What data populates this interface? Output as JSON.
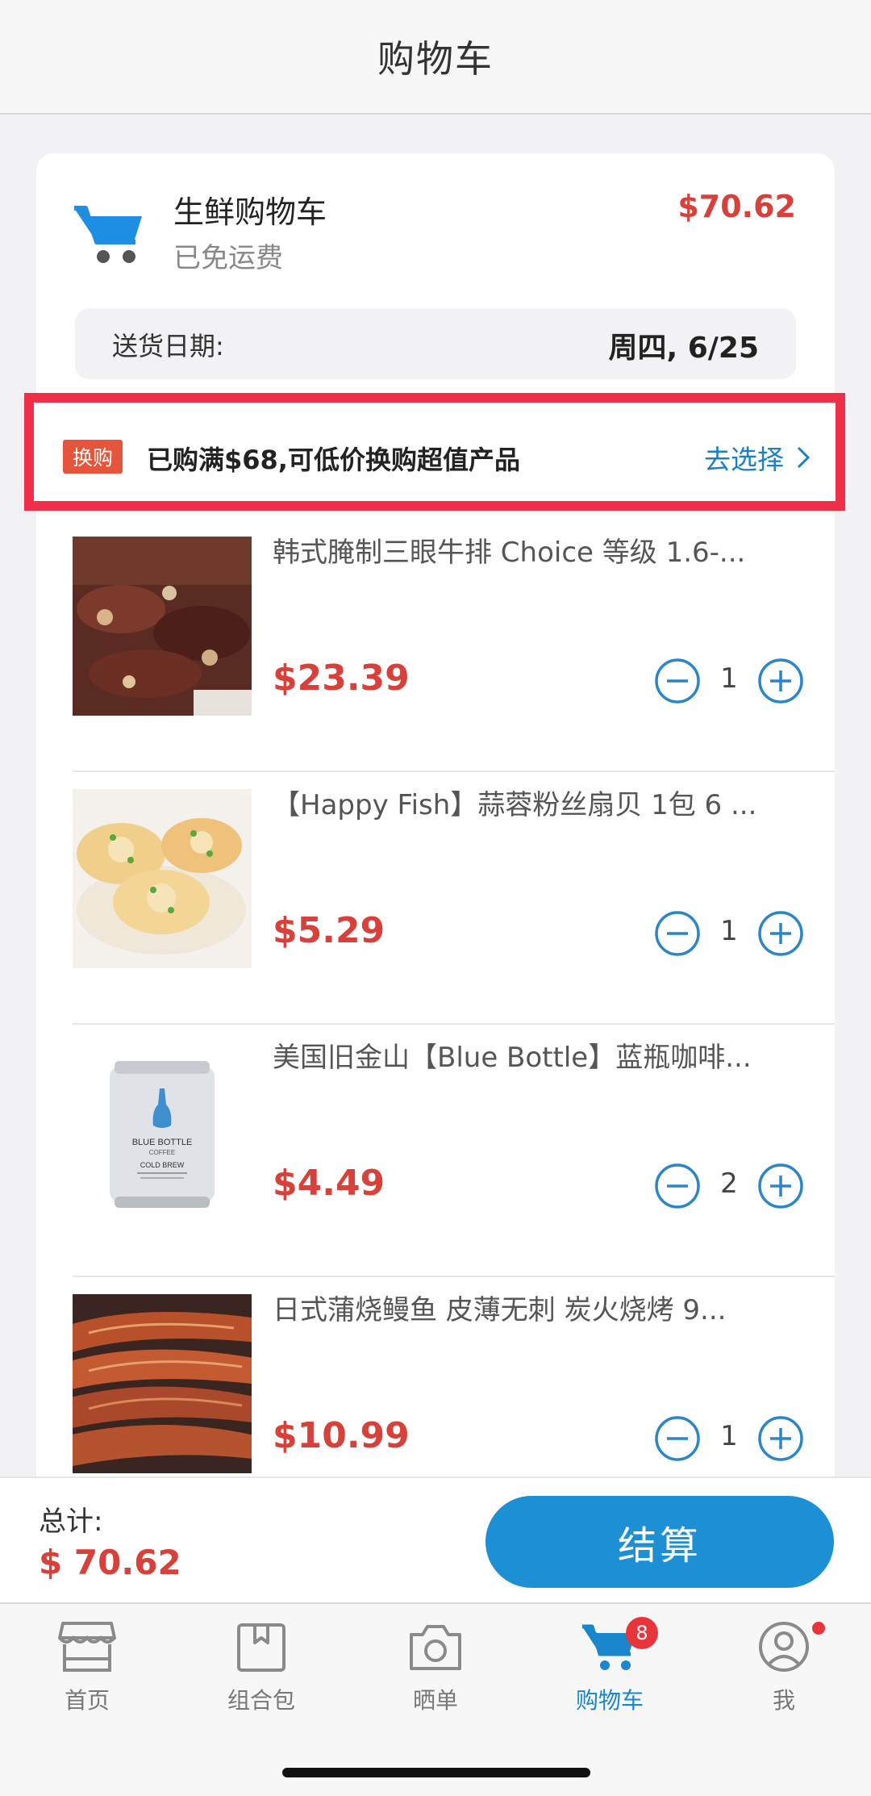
{
  "header": {
    "title": "购物车"
  },
  "cart": {
    "name": "生鲜购物车",
    "shipping_note": "已免运费",
    "total": "$70.62",
    "delivery_label": "送货日期:",
    "delivery_value": "周四, 6/25"
  },
  "promo": {
    "badge": "换购",
    "text": "已购满$68,可低价换购超值产品",
    "link": "去选择"
  },
  "items": [
    {
      "name": "韩式腌制三眼牛排 Choice 等级 1.6-...",
      "price": "$23.39",
      "qty": "1",
      "image": "beef-short-ribs-photo"
    },
    {
      "name": "【Happy Fish】蒜蓉粉丝扇贝 1包 6 ...",
      "price": "$5.29",
      "qty": "1",
      "image": "garlic-scallops-photo"
    },
    {
      "name": "美国旧金山【Blue Bottle】蓝瓶咖啡...",
      "price": "$4.49",
      "qty": "2",
      "image": "blue-bottle-can-photo",
      "can_text": {
        "brand": "BLUE BOTTLE",
        "sub": "COFFEE",
        "product": "COLD BREW"
      }
    },
    {
      "name": "日式蒲烧鳗鱼 皮薄无刺 炭火烧烤 9...",
      "price": "$10.99",
      "qty": "1",
      "image": "grilled-eel-photo"
    }
  ],
  "footer": {
    "total_label": "总计:",
    "total_value": "$ 70.62",
    "checkout_label": "结算"
  },
  "tabs": [
    {
      "label": "首页",
      "icon": "store-icon"
    },
    {
      "label": "组合包",
      "icon": "package-icon"
    },
    {
      "label": "晒单",
      "icon": "camera-icon"
    },
    {
      "label": "购物车",
      "icon": "cart-icon",
      "badge": "8",
      "active": true
    },
    {
      "label": "我",
      "icon": "profile-icon"
    }
  ],
  "colors": {
    "accent": "#1d8fd5",
    "price": "#d8403a",
    "highlight_frame": "#f0304a"
  }
}
